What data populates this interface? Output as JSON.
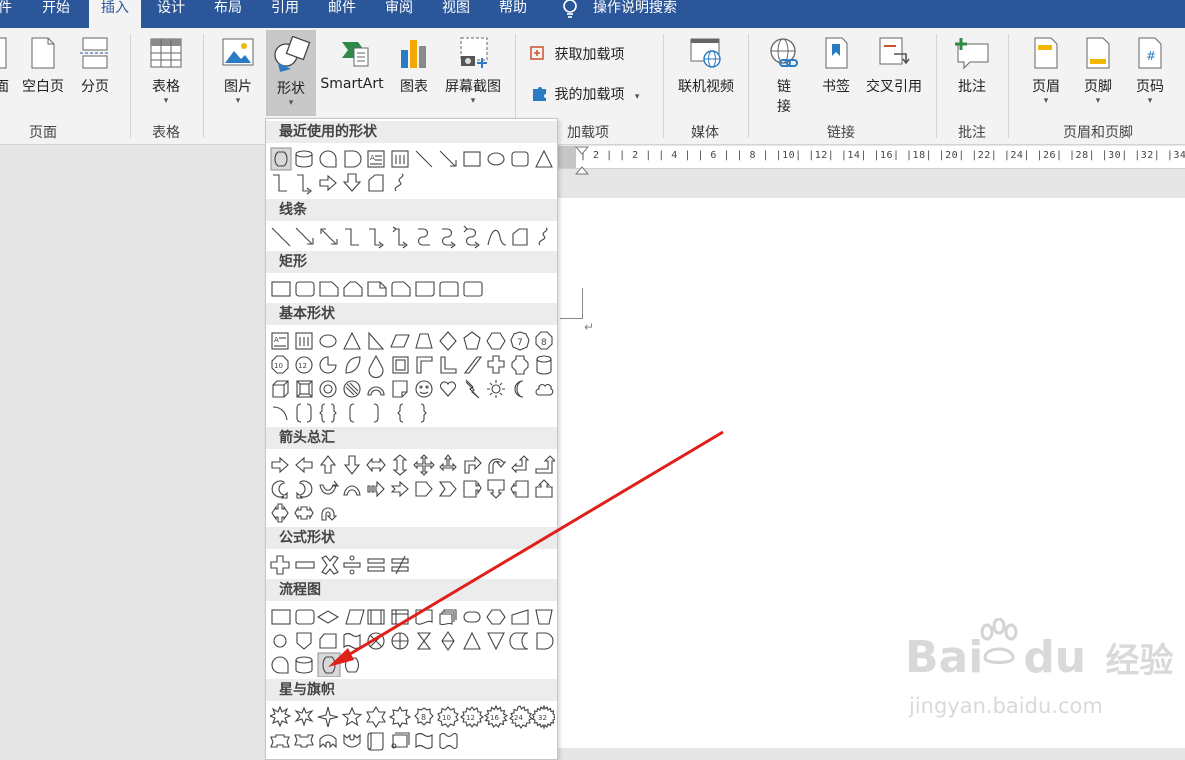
{
  "ribbon_tabs": [
    "件",
    "开始",
    "插入",
    "设计",
    "布局",
    "引用",
    "邮件",
    "审阅",
    "视图",
    "帮助"
  ],
  "active_tab": "插入",
  "tell_me": "操作说明搜索",
  "groups": {
    "pages": {
      "label": "页面",
      "cover": "面",
      "blank": "空白页",
      "break": "分页"
    },
    "tables": {
      "label": "表格",
      "table": "表格"
    },
    "illustrations": {
      "pictures": "图片",
      "shapes": "形状",
      "smartart": "SmartArt",
      "chart": "图表",
      "screenshot": "屏幕截图"
    },
    "addins": {
      "label": "加载项",
      "get": "获取加载项",
      "my": "我的加载项"
    },
    "media": {
      "label": "媒体",
      "video": "联机视频"
    },
    "links": {
      "label": "链接",
      "link_l1": "链",
      "link_l2": "接",
      "bookmark": "书签",
      "crossref": "交叉引用"
    },
    "comments": {
      "label": "批注",
      "comment": "批注"
    },
    "headerfooter": {
      "label": "页眉和页脚",
      "header": "页眉",
      "footer": "页脚",
      "pagenum": "页码"
    }
  },
  "ruler": "| 2 |   | 2 |   | 4 |   | 6 |   | 8 |   |10|   |12|   |14|   |16|   |18|   |20|   |22|   |24|   |26|   |28|   |30|   |32|   |34",
  "shape_menu": {
    "categories": [
      "最近使用的形状",
      "线条",
      "矩形",
      "基本形状",
      "箭头总汇",
      "公式形状",
      "流程图",
      "星与旗帜"
    ]
  },
  "watermark": {
    "brand_main": "Bai",
    "brand_du": "du",
    "brand_cn": "经验",
    "url": "jingyan.baidu.com"
  },
  "colors": {
    "tab_bar": "#2b579a",
    "ribbon": "#f3f3f3",
    "arrow": "#e0201a"
  }
}
